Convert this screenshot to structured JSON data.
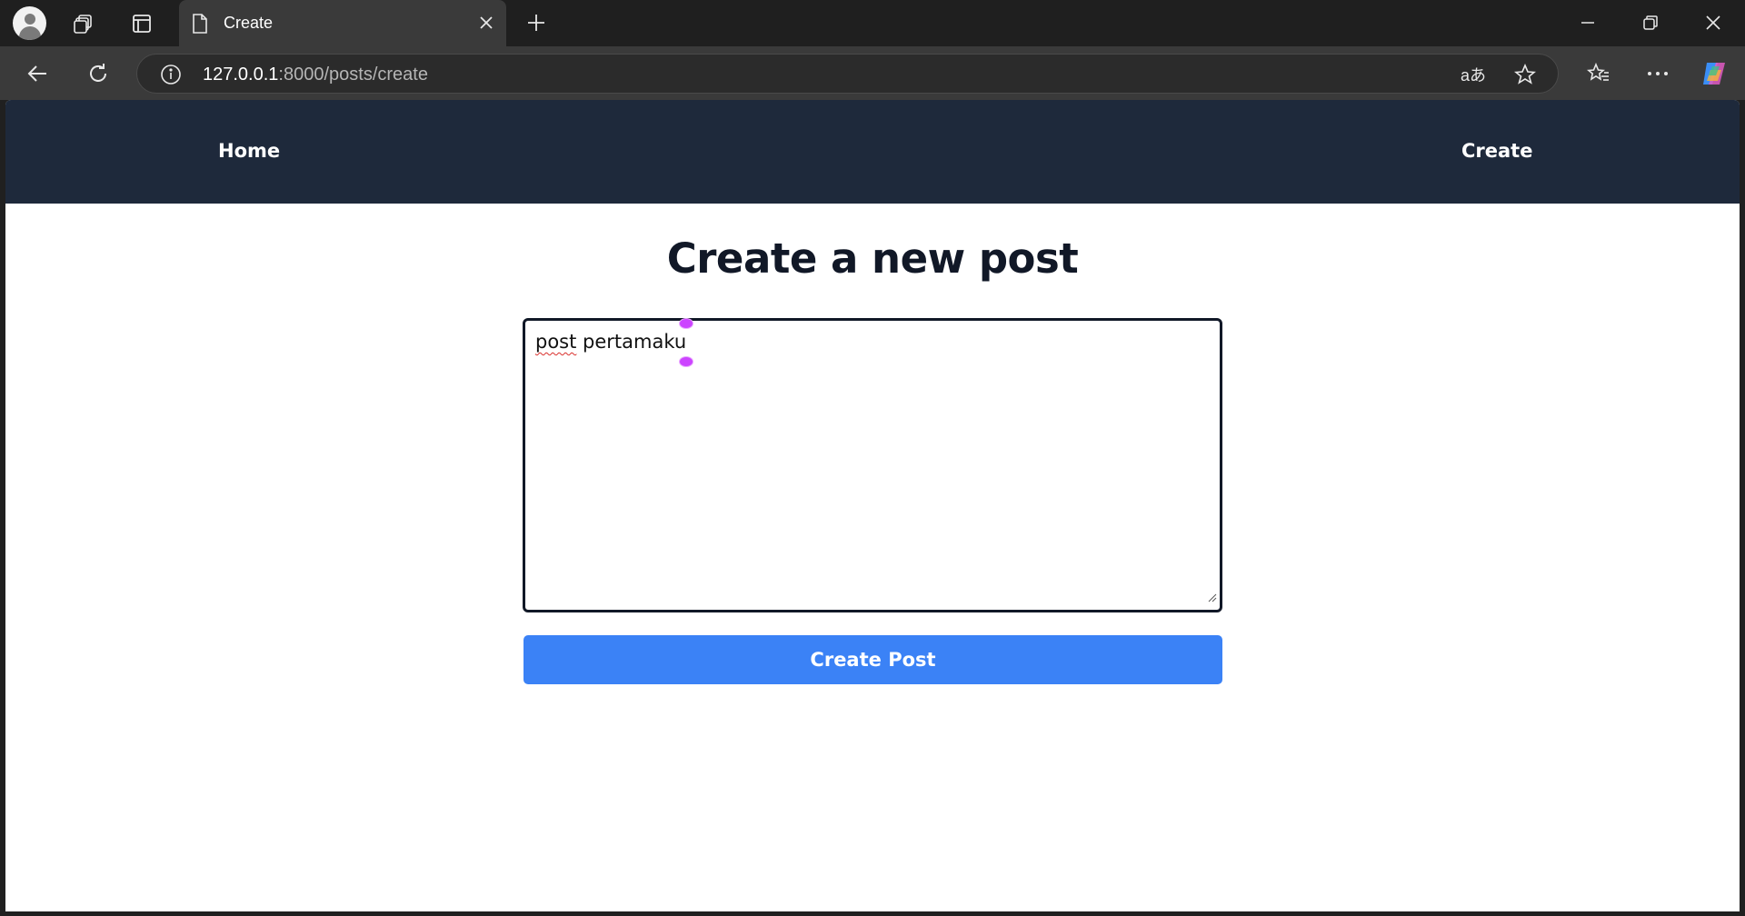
{
  "browser": {
    "tab_title": "Create",
    "url_host": "127.0.0.1",
    "url_rest": ":8000/posts/create",
    "icons": [
      "profile-avatar",
      "workspaces-icon",
      "tab-actions-icon",
      "document-icon",
      "close-icon",
      "new-tab-icon",
      "minimize-icon",
      "restore-icon",
      "window-close-icon",
      "back-icon",
      "refresh-icon",
      "info-icon",
      "read-aloud-icon",
      "favorite-star-icon",
      "favorites-icon",
      "more-icon",
      "copilot-icon"
    ]
  },
  "navbar": {
    "home_label": "Home",
    "create_label": "Create",
    "background": "#1e293b"
  },
  "form": {
    "heading": "Create a new post",
    "textarea_misspelled_word": "post",
    "textarea_rest": " pertamaku",
    "submit_label": "Create Post",
    "accent": "#3b82f6"
  }
}
